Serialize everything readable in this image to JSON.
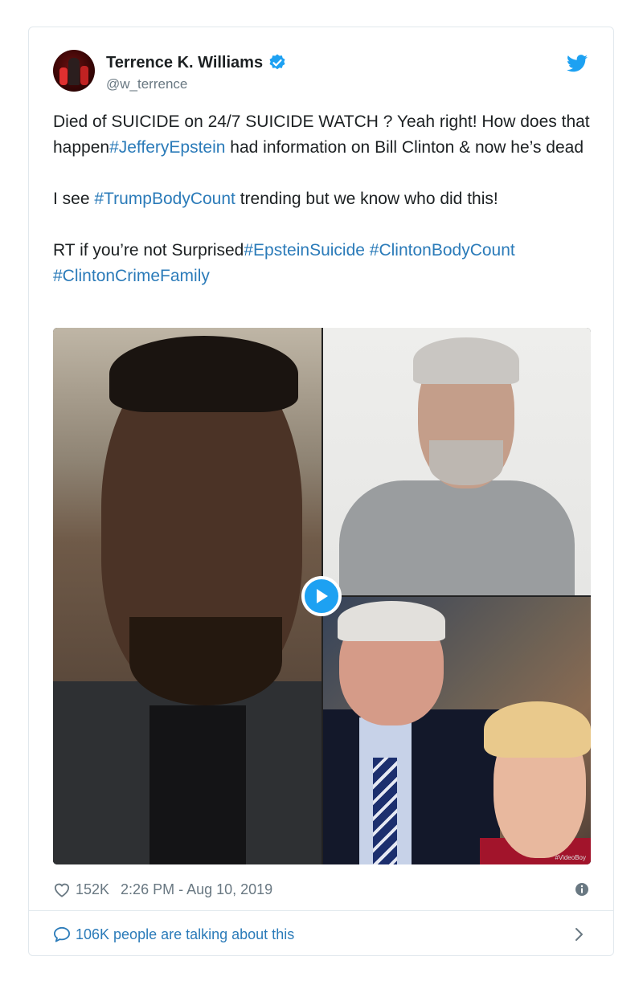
{
  "author": {
    "name": "Terrence K. Williams",
    "handle": "@w_terrence"
  },
  "tweet": {
    "line1_a": "Died of SUICIDE on 24/7 SUICIDE WATCH ? Yeah right! How does that happen",
    "line1_tag": "#JefferyEpstein",
    "line1_b": " had information on Bill Clinton & now he’s dead",
    "line2_a": "I see ",
    "line2_tag": "#TrumpBodyCount",
    "line2_b": " trending but we know who did this!",
    "line3_a": "RT if you’re not Surprised",
    "line3_tag1": "#EpsteinSuicide",
    "line3_tag2": "#ClintonBodyCount",
    "line3_tag3": "#ClintonCrimeFamily"
  },
  "media": {
    "watermark": "#VideoBoy"
  },
  "meta": {
    "likes": "152K",
    "timestamp": "2:26 PM - Aug 10, 2019"
  },
  "footer": {
    "talking": "106K people are talking about this"
  },
  "colors": {
    "link": "#2b7bb9",
    "verified": "#1da1f2",
    "muted": "#697882"
  },
  "icons": [
    "verified-badge-icon",
    "twitter-bird-icon",
    "play-icon",
    "heart-icon",
    "info-icon",
    "speech-bubble-icon",
    "chevron-right-icon"
  ]
}
